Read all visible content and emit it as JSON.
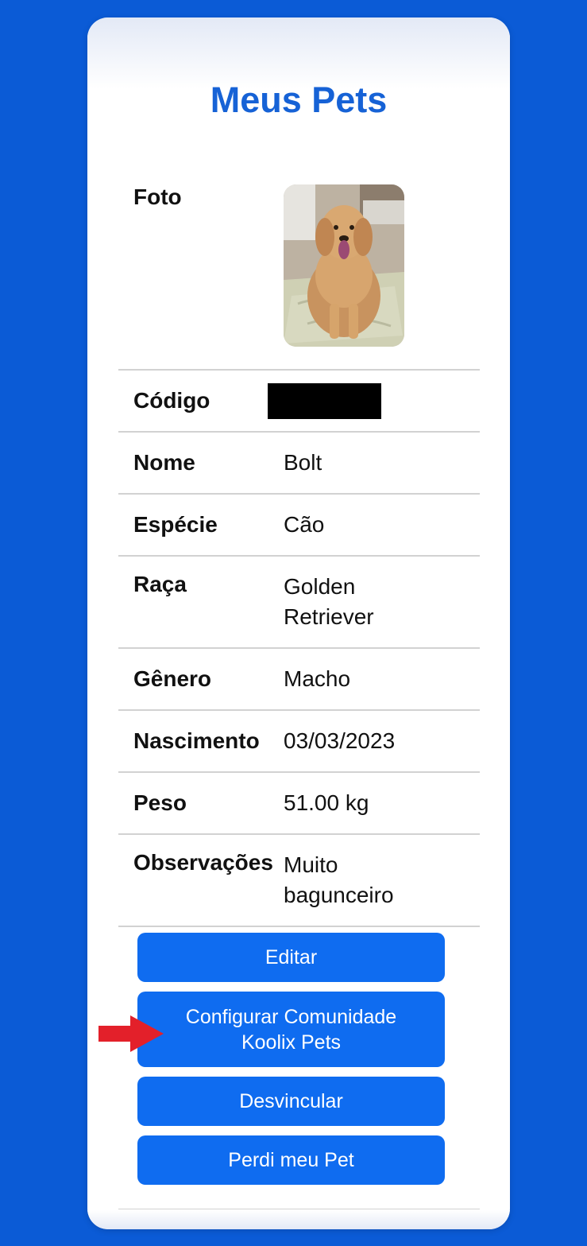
{
  "title": "Meus Pets",
  "fields": {
    "foto_label": "Foto",
    "codigo_label": "Código",
    "nome_label": "Nome",
    "nome_value": "Bolt",
    "especie_label": "Espécie",
    "especie_value": "Cão",
    "raca_label": "Raça",
    "raca_value_line1": "Golden",
    "raca_value_line2": "Retriever",
    "genero_label": "Gênero",
    "genero_value": "Macho",
    "nascimento_label": "Nascimento",
    "nascimento_value": "03/03/2023",
    "peso_label": "Peso",
    "peso_value": "51.00 kg",
    "observacoes_label": "Observações",
    "observacoes_value_line1": "Muito",
    "observacoes_value_line2": "bagunceiro"
  },
  "buttons": {
    "edit": "Editar",
    "config_line1": "Configurar Comunidade",
    "config_line2": "Koolix Pets",
    "unlink": "Desvincular",
    "lost": "Perdi meu Pet"
  },
  "colors": {
    "background": "#0b5bd6",
    "title": "#1662d6",
    "button": "#0f6cf0",
    "arrow": "#e3202a"
  },
  "icons": {
    "annotation_arrow": "red-arrow-right",
    "pet_photo": "golden-retriever-photo"
  }
}
